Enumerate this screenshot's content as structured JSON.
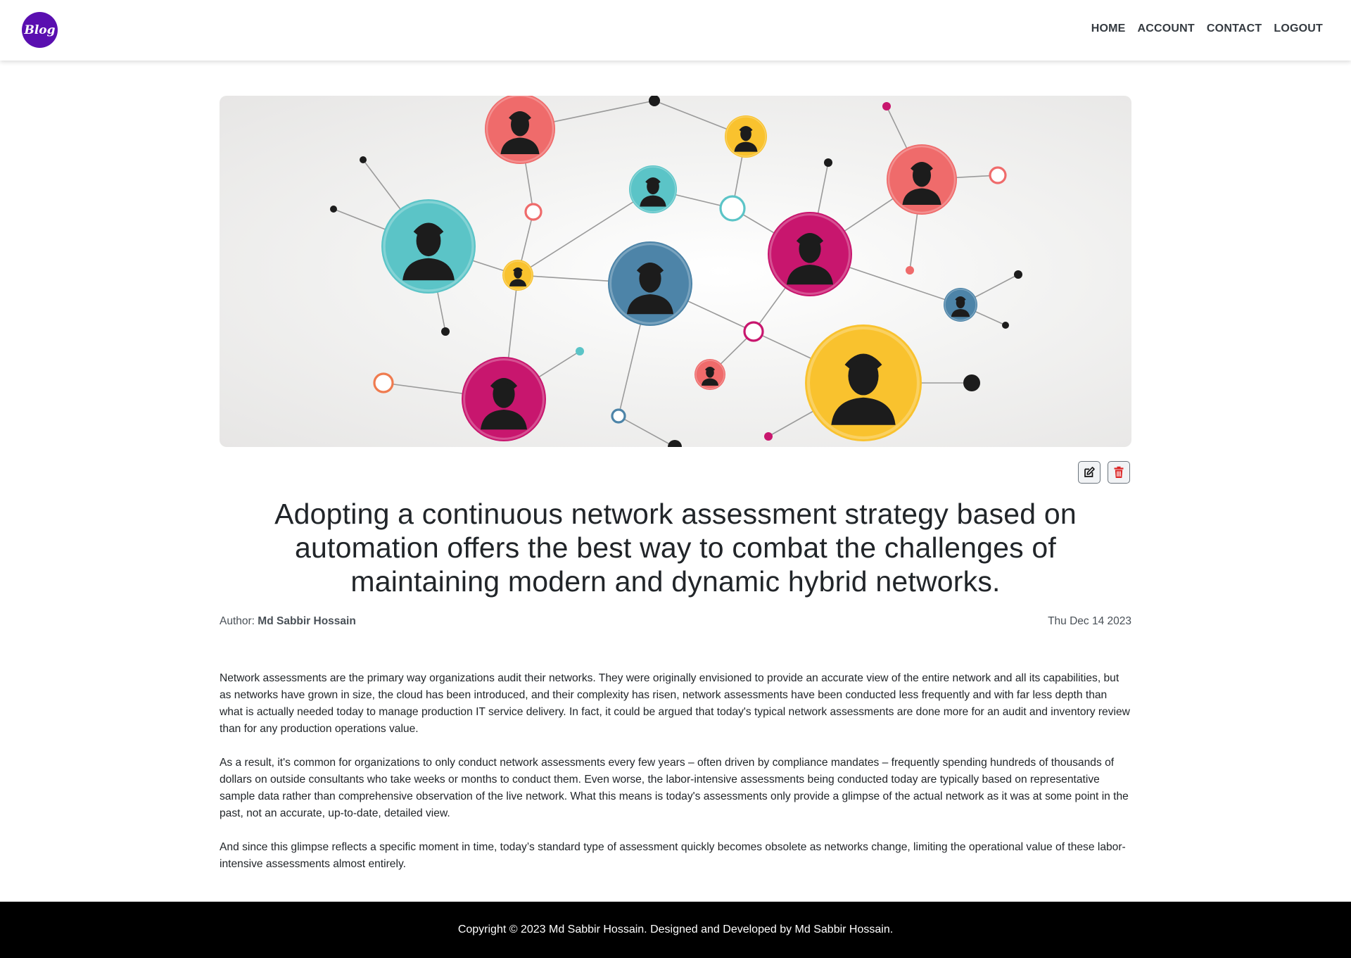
{
  "nav": {
    "logo_text": "Blog",
    "links": [
      "HOME",
      "ACCOUNT",
      "CONTACT",
      "LOGOUT"
    ]
  },
  "hero": {
    "icon": "people-network-illustration",
    "colors": {
      "teal": "#5bc4c7",
      "coral": "#ef6b6b",
      "magenta": "#c8166e",
      "yellow": "#f9c22e",
      "steel": "#4d84a8",
      "silhouette": "#1c1c1c"
    }
  },
  "actions": {
    "edit_icon": "edit-icon",
    "delete_icon": "trash-icon"
  },
  "post": {
    "title": "Adopting a continuous network assessment strategy based on automation offers the best way to combat the challenges of maintaining modern and dynamic hybrid networks.",
    "author_label": "Author:",
    "author_name": "Md Sabbir Hossain",
    "date": "Thu Dec 14 2023",
    "paragraphs": [
      "Network assessments are the primary way organizations audit their networks. They were originally envisioned to provide an accurate view of the entire network and all its capabilities, but as networks have grown in size, the cloud has been introduced, and their complexity has risen, network assessments have been conducted less frequently and with far less depth than what is actually needed today to manage production IT service delivery. In fact, it could be argued that today's typical network assessments are done more for an audit and inventory review than for any production operations value.",
      "As a result, it's common for organizations to only conduct network assessments every few years – often driven by compliance mandates – frequently spending hundreds of thousands of dollars on outside consultants who take weeks or months to conduct them. Even worse, the labor-intensive assessments being conducted today are typically based on representative sample data rather than comprehensive observation of the live network. What this means is today's assessments only provide a glimpse of the actual network as it was at some point in the past, not an accurate, up-to-date, detailed view.",
      "And since this glimpse reflects a specific moment in time, today’s standard type of assessment quickly becomes obsolete as networks change, limiting the operational value of these labor-intensive assessments almost entirely."
    ]
  },
  "footer": {
    "text": "Copyright © 2023 Md Sabbir Hossain. Designed and Developed by Md Sabbir Hossain."
  }
}
